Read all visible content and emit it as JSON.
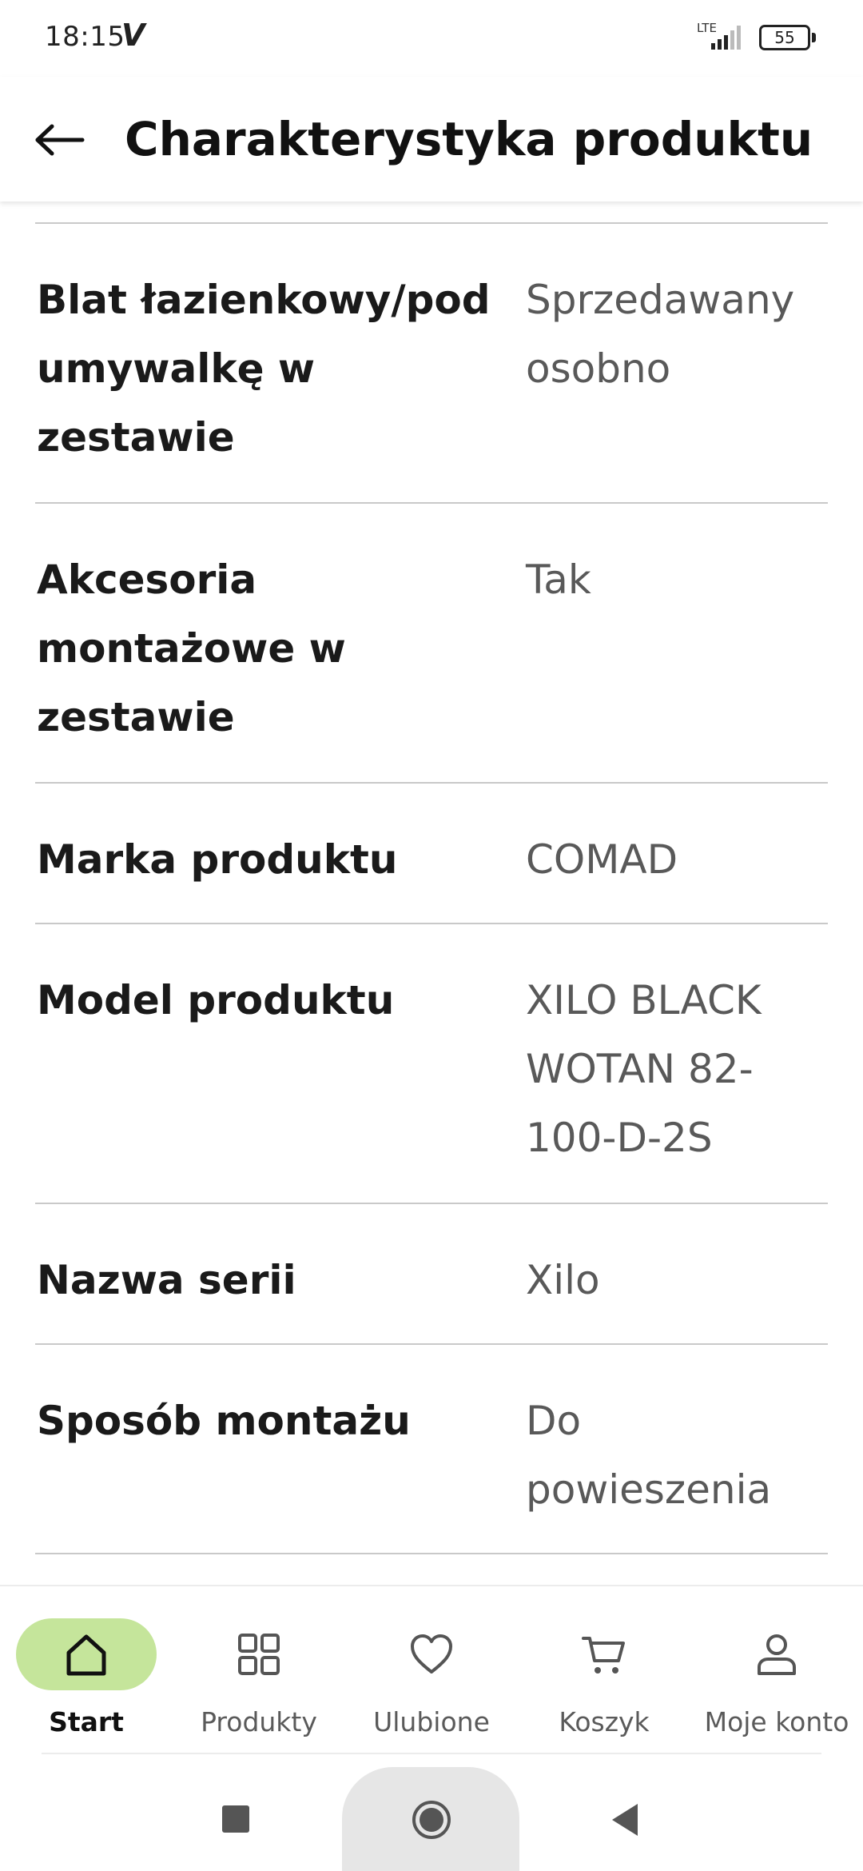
{
  "status_bar": {
    "time": "18:15",
    "carrier_glyph": "V",
    "network": "LTE",
    "battery": "55"
  },
  "app_bar": {
    "title": "Charakterystyka produktu"
  },
  "specs": [
    {
      "label": "Blat łazienkowy/pod umywalkę w zestawie",
      "value": "Sprzedawany osobno"
    },
    {
      "label": "Akcesoria montażowe w zestawie",
      "value": "Tak"
    },
    {
      "label": "Marka produktu",
      "value": "COMAD"
    },
    {
      "label": "Model produktu",
      "value": "XILO BLACK WOTAN 82-100-D-2S"
    },
    {
      "label": "Nazwa serii",
      "value": "Xilo"
    },
    {
      "label": "Sposób montażu",
      "value": "Do powieszenia"
    }
  ],
  "bottom_nav": {
    "items": [
      {
        "label": "Start",
        "icon": "home-icon",
        "active": true
      },
      {
        "label": "Produkty",
        "icon": "grid-icon",
        "active": false
      },
      {
        "label": "Ulubione",
        "icon": "heart-icon",
        "active": false
      },
      {
        "label": "Koszyk",
        "icon": "cart-icon",
        "active": false
      },
      {
        "label": "Moje konto",
        "icon": "user-icon",
        "active": false
      }
    ]
  },
  "colors": {
    "accent_pill": "#c5e59b",
    "label_text": "#1a1a1a",
    "value_text": "#595959",
    "divider": "#c9c9c9"
  }
}
